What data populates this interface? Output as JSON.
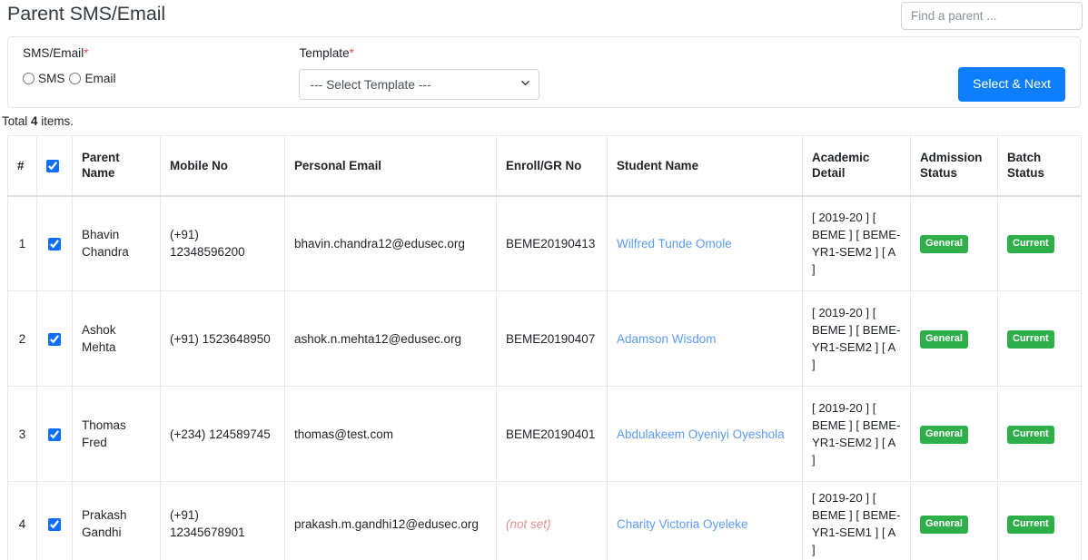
{
  "header": {
    "title": "Parent SMS/Email",
    "search": {
      "placeholder": "Find a parent ...",
      "value": ""
    }
  },
  "filter": {
    "sms_email": {
      "label": "SMS/Email",
      "required_mark": "*",
      "options": [
        {
          "label": "SMS",
          "value": "sms",
          "selected": false
        },
        {
          "label": "Email",
          "value": "email",
          "selected": false
        }
      ]
    },
    "template": {
      "label": "Template",
      "required_mark": "*",
      "selected": "--- Select Template ---",
      "options": [
        "--- Select Template ---"
      ]
    },
    "submit_label": "Select & Next"
  },
  "summary": {
    "prefix": "Total",
    "count": "4",
    "suffix": "items."
  },
  "table": {
    "columns": [
      "#",
      "select-all",
      "Parent Name",
      "Mobile No",
      "Personal Email",
      "Enroll/GR No",
      "Student Name",
      "Academic Detail",
      "Admission Status",
      "Batch Status"
    ],
    "select_all_checked": true,
    "rows": [
      {
        "num": "1",
        "checked": true,
        "parent_name": "Bhavin Chandra",
        "mobile_no": "(+91) 12348596200",
        "personal_email": "bhavin.chandra12@edusec.org",
        "enroll_no": "BEME20190413",
        "enroll_not_set": false,
        "student_name": "Wilfred Tunde Omole",
        "academic_detail": "[ 2019-20 ] [ BEME ] [ BEME-YR1-SEM2 ] [ A ]",
        "admission_status": "General",
        "batch_status": "Current"
      },
      {
        "num": "2",
        "checked": true,
        "parent_name": "Ashok Mehta",
        "mobile_no": "(+91) 1523648950",
        "personal_email": "ashok.n.mehta12@edusec.org",
        "enroll_no": "BEME20190407",
        "enroll_not_set": false,
        "student_name": "Adamson Wisdom",
        "academic_detail": "[ 2019-20 ] [ BEME ] [ BEME-YR1-SEM2 ] [ A ]",
        "admission_status": "General",
        "batch_status": "Current"
      },
      {
        "num": "3",
        "checked": true,
        "parent_name": "Thomas Fred",
        "mobile_no": "(+234) 124589745",
        "personal_email": "thomas@test.com",
        "enroll_no": "BEME20190401",
        "enroll_not_set": false,
        "student_name": "Abdulakeem Oyeniyi Oyeshola",
        "academic_detail": "[ 2019-20 ] [ BEME ] [ BEME-YR1-SEM2 ] [ A ]",
        "admission_status": "General",
        "batch_status": "Current"
      },
      {
        "num": "4",
        "checked": true,
        "parent_name": "Prakash Gandhi",
        "mobile_no": "(+91) 12345678901",
        "personal_email": "prakash.m.gandhi12@edusec.org",
        "enroll_no": "(not set)",
        "enroll_not_set": true,
        "student_name": "Charity Victoria Oyeleke",
        "academic_detail": "[ 2019-20 ] [ BEME ] [ BEME-YR1-SEM1 ] [ A ]",
        "admission_status": "General",
        "batch_status": "Current"
      }
    ]
  },
  "colors": {
    "primary": "#0d7efd",
    "badge_green": "#2eaf4a",
    "link_blue": "#5b9bf8",
    "required_red": "#e74c3c",
    "notset_red": "#e38e8e"
  }
}
